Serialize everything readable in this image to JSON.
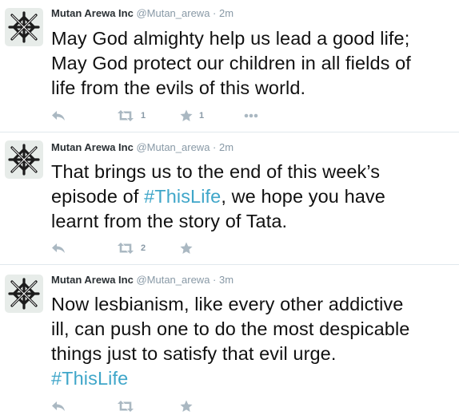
{
  "tweets": [
    {
      "author_name": "Mutan Arewa Inc",
      "author_handle": "@Mutan_arewa",
      "separator": "·",
      "time": "2m",
      "text_lines": [
        "May God almighty help us lead a good life;",
        "May God protect our children in all fields of",
        "life from the evils of this world."
      ],
      "retweets": "1",
      "favorites": "1"
    },
    {
      "author_name": "Mutan Arewa Inc",
      "author_handle": "@Mutan_arewa",
      "separator": "·",
      "time": "2m",
      "text_parts": {
        "line1": "That brings us to the end of this week’s",
        "line2_before": "episode of ",
        "line2_hashtag": "#ThisLife",
        "line2_after": ", we hope you have",
        "line3": "learnt from the story of Tata."
      },
      "retweets": "2",
      "favorites": ""
    },
    {
      "author_name": "Mutan Arewa Inc",
      "author_handle": "@Mutan_arewa",
      "separator": "·",
      "time": "3m",
      "text_lines": [
        "Now lesbianism, like every other addictive",
        "ill, can push one to do the most despicable",
        "things just to satisfy that evil urge."
      ],
      "hashtag": "#ThisLife",
      "retweets": "",
      "favorites": ""
    }
  ],
  "icons": {
    "avatar": "knot-logo-icon",
    "reply": "reply-icon",
    "retweet": "retweet-icon",
    "favorite": "star-icon",
    "more": "more-dots-icon"
  },
  "colors": {
    "hashtag": "#3fa6c9",
    "meta": "#8899a6",
    "icon": "#aab8c2",
    "divider": "#e1e8ed"
  }
}
